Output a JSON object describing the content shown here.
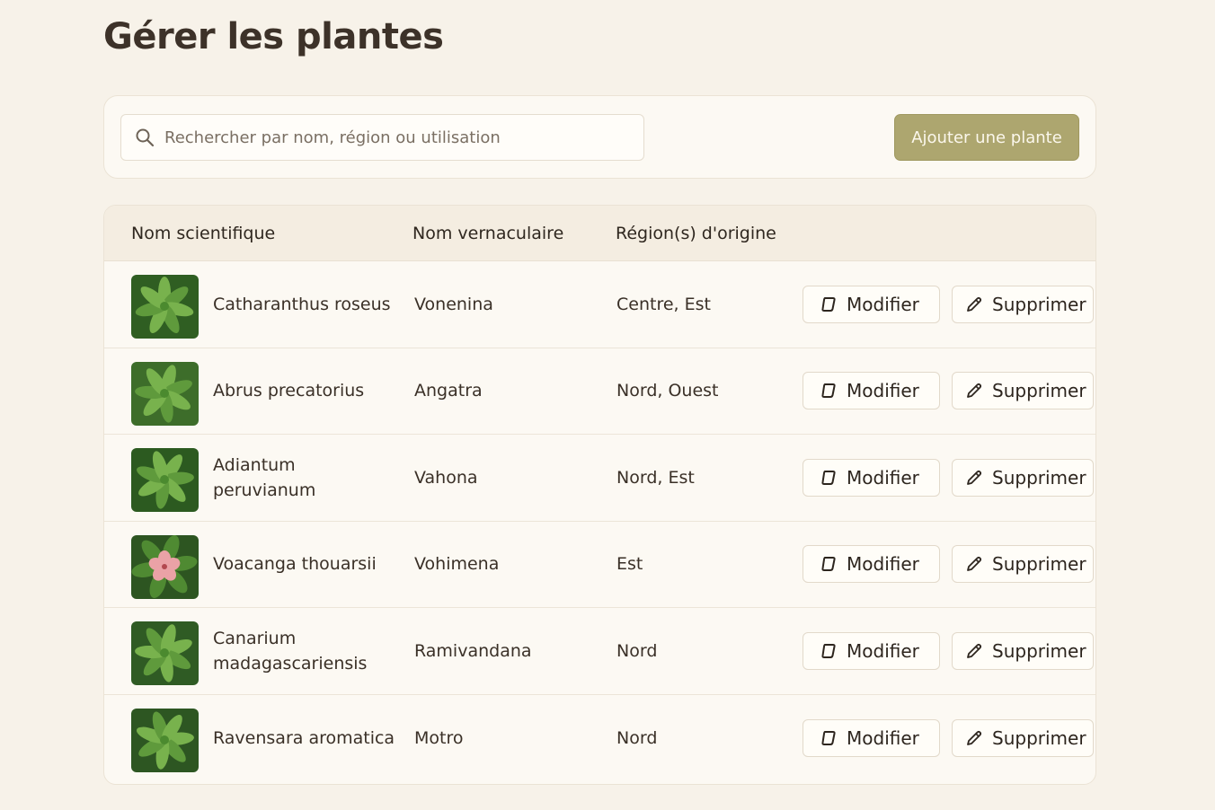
{
  "page": {
    "title": "Gérer les plantes"
  },
  "toolbar": {
    "search_placeholder": "Rechercher par nom, région ou utilisation",
    "search_icon": "search-icon",
    "add_label": "Ajouter une plante",
    "add_color": "#ada66f"
  },
  "table": {
    "headers": [
      "Nom scientifique",
      "Nom vernaculaire",
      "Région(s) d'origine"
    ],
    "edit_label": "Modifier",
    "delete_label": "Supprimer",
    "rows": [
      {
        "scientific": "Catharanthus roseus",
        "common": "Vonenina",
        "regions": "Centre, Est",
        "thumb": "leaf-photo"
      },
      {
        "scientific": "Abrus precatorius",
        "common": "Angatra",
        "regions": "Nord, Ouest",
        "thumb": "leaf-photo"
      },
      {
        "scientific": "Adiantum peruvianum",
        "common": "Vahona",
        "regions": "Nord, Est",
        "thumb": "leaf-photo"
      },
      {
        "scientific": "Voacanga thouarsii",
        "common": "Vohimena",
        "regions": "Est",
        "thumb": "flower-photo"
      },
      {
        "scientific": "Canarium madagascariensis",
        "common": "Ramivandana",
        "regions": "Nord",
        "thumb": "leaf-photo"
      },
      {
        "scientific": "Ravensara aromatica",
        "common": "Motro",
        "regions": "Nord",
        "thumb": "leaf-photo"
      }
    ]
  }
}
